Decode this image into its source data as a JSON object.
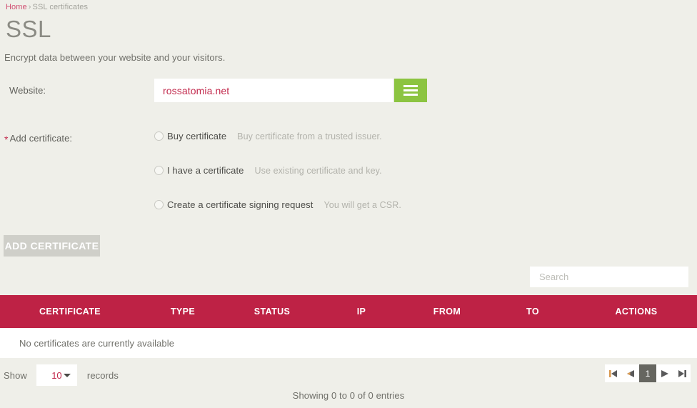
{
  "breadcrumb": {
    "home_label": "Home",
    "separator": "›",
    "current_label": "SSL certificates"
  },
  "header": {
    "title": "SSL",
    "subtitle": "Encrypt data between your website and your visitors."
  },
  "form": {
    "website": {
      "label": "Website:",
      "value": "rossatomia.net",
      "menu_icon": "hamburger-icon"
    },
    "add_certificate": {
      "required_marker": "*",
      "label": "Add certificate:",
      "options": [
        {
          "label": "Buy certificate",
          "hint": "Buy certificate from a trusted issuer.",
          "selected": false
        },
        {
          "label": "I have a certificate",
          "hint": "Use existing certificate and key.",
          "selected": false
        },
        {
          "label": "Create a certificate signing request",
          "hint": "You will get a CSR.",
          "selected": false
        }
      ]
    },
    "submit_label": "ADD CERTIFICATE"
  },
  "search": {
    "placeholder": "Search",
    "value": ""
  },
  "table": {
    "columns": [
      "CERTIFICATE",
      "TYPE",
      "STATUS",
      "IP",
      "FROM",
      "TO",
      "ACTIONS"
    ],
    "rows": [],
    "empty_message": "No certificates are currently available"
  },
  "footer": {
    "show_label": "Show",
    "records_value": "10",
    "records_label": "records",
    "entries_info": "Showing 0 to 0 of 0 entries",
    "pagination": {
      "first_icon": "first-page-icon",
      "prev_icon": "previous-page-icon",
      "current_page": "1",
      "next_icon": "next-page-icon",
      "last_icon": "last-page-icon"
    }
  },
  "colors": {
    "brand_crimson": "#be2245",
    "accent_green": "#8cc441",
    "page_background": "#efefe9",
    "link_pink": "#d14f72"
  }
}
